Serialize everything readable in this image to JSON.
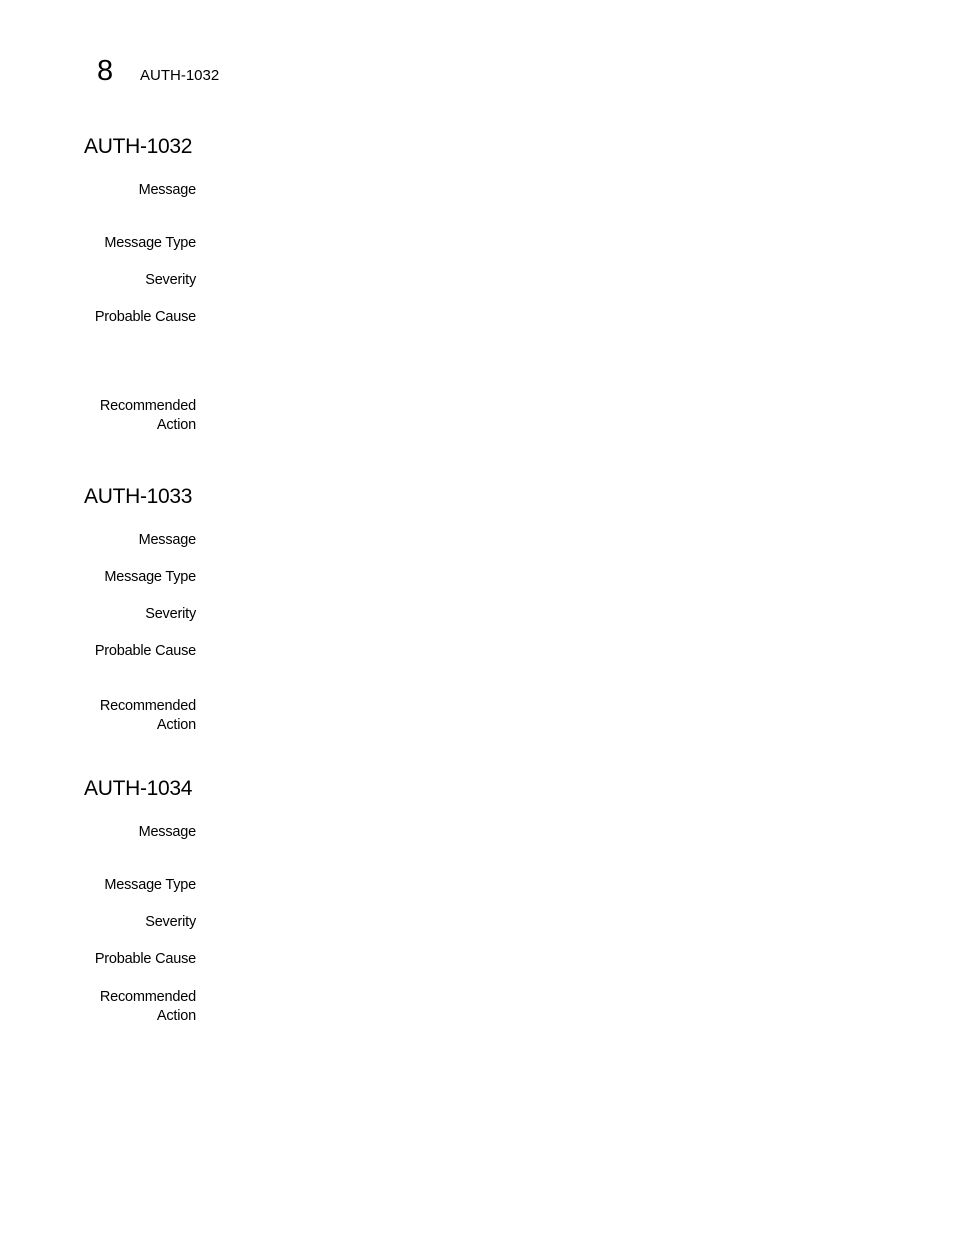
{
  "header": {
    "chapter_number": "8",
    "running_title": "AUTH-1032"
  },
  "labels": {
    "message": "Message",
    "message_type": "Message Type",
    "severity": "Severity",
    "probable_cause": "Probable Cause",
    "recommended_action_line1": "Recommended",
    "recommended_action_line2": "Action"
  },
  "sections": [
    {
      "title": "AUTH-1032"
    },
    {
      "title": "AUTH-1033"
    },
    {
      "title": "AUTH-1034"
    }
  ]
}
